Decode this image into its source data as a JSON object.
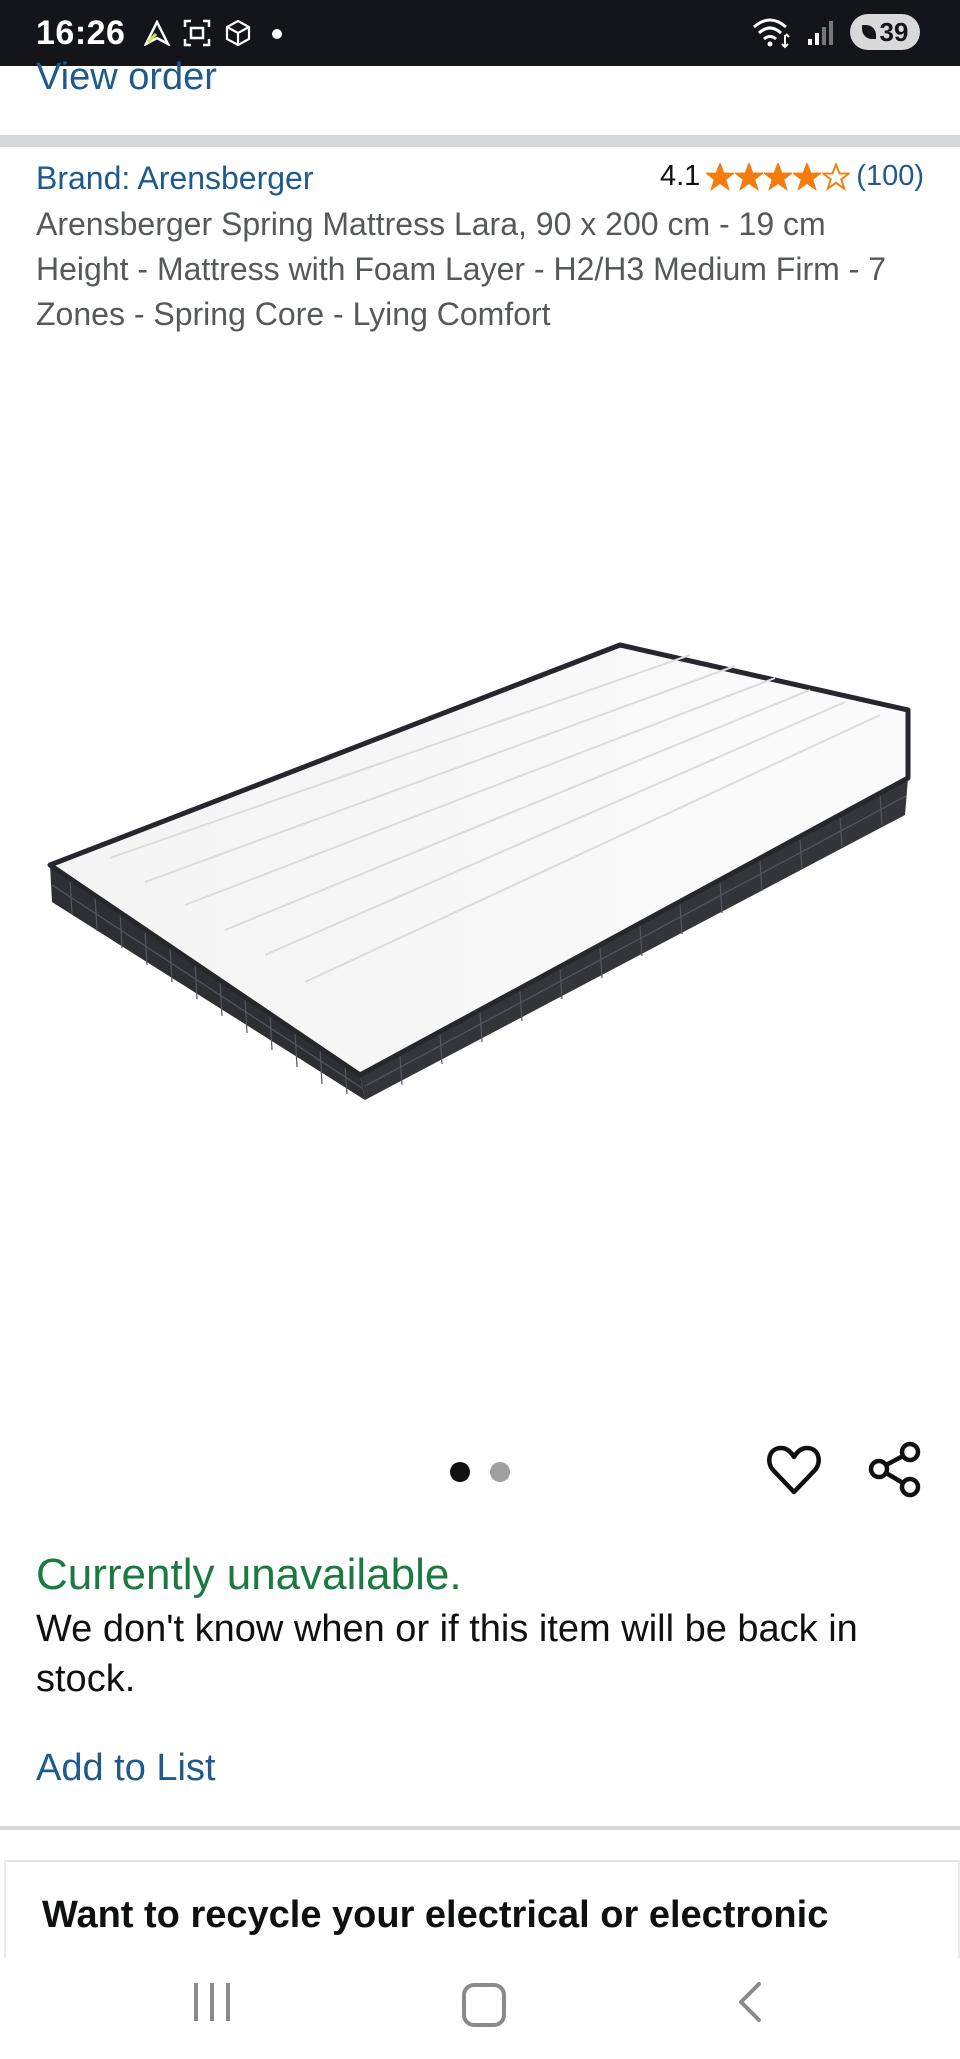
{
  "status_bar": {
    "time": "16:26",
    "battery": "39",
    "left_icons": [
      "navigation-icon",
      "screenshot-icon",
      "cube-icon",
      "dot-icon"
    ],
    "right_icons": [
      "wifi-icon",
      "signal-icon",
      "battery-icon"
    ]
  },
  "top": {
    "view_order": "View order"
  },
  "product": {
    "brand": "Brand: Arensberger",
    "rating_score": "4.1",
    "rating_count": "(100)",
    "rating_value": 4.1,
    "star_color": "#f47c0c",
    "title": "Arensberger Spring Mattress Lara, 90 x 200 cm - 19 cm Height - Mattress with Foam Layer - H2/H3 Medium Firm - 7 Zones - Spring Core - Lying Comfort"
  },
  "carousel": {
    "image_count": 2,
    "active_index": 0
  },
  "availability": {
    "status": "Currently unavailable.",
    "note": "We don't know when or if this item will be back in stock.",
    "status_color": "#1a7a3f"
  },
  "actions": {
    "add_to_list": "Add to List"
  },
  "recycle": {
    "heading": "Want to recycle your electrical or electronic"
  },
  "nav_bar": {
    "icons": [
      "recents-icon",
      "home-icon",
      "back-icon"
    ]
  }
}
